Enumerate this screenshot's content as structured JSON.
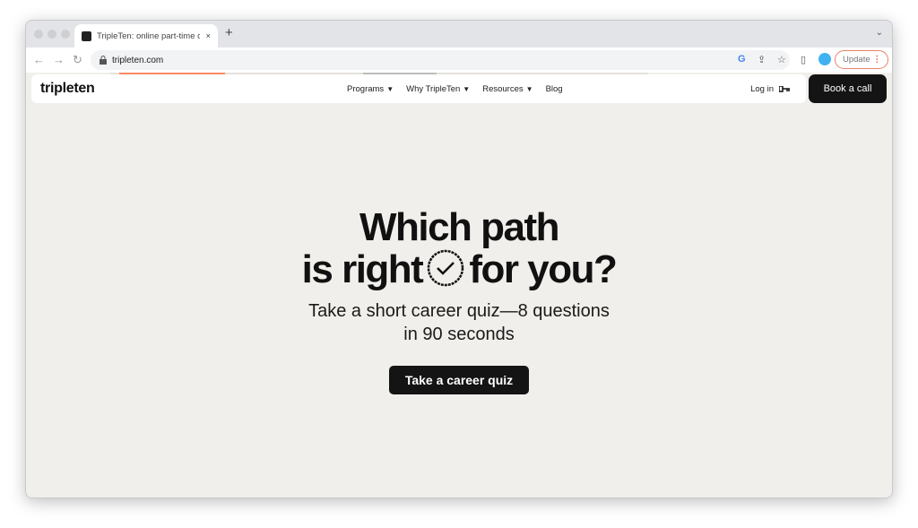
{
  "browser": {
    "tab_title": "TripleTen: online part-time coding bootcamp",
    "url": "tripleten.com",
    "update_label": "Update",
    "new_tab": "+",
    "tab_close": "×"
  },
  "site": {
    "logo": "tripleten",
    "menu": [
      {
        "label": "Programs"
      },
      {
        "label": "Why TripleTen"
      },
      {
        "label": "Resources"
      },
      {
        "label": "Blog"
      }
    ],
    "login": "Log in",
    "book_call": "Book a call"
  },
  "hero": {
    "title_line1": "Which path",
    "title_line2a": "is right",
    "title_line2b": "for you?",
    "subtitle_line1": "Take a short career quiz—8 questions",
    "subtitle_line2": "in 90 seconds",
    "cta": "Take a career quiz"
  },
  "colors": {
    "accent": "#f88a62",
    "button": "#141414",
    "background": "#f1efeb"
  }
}
